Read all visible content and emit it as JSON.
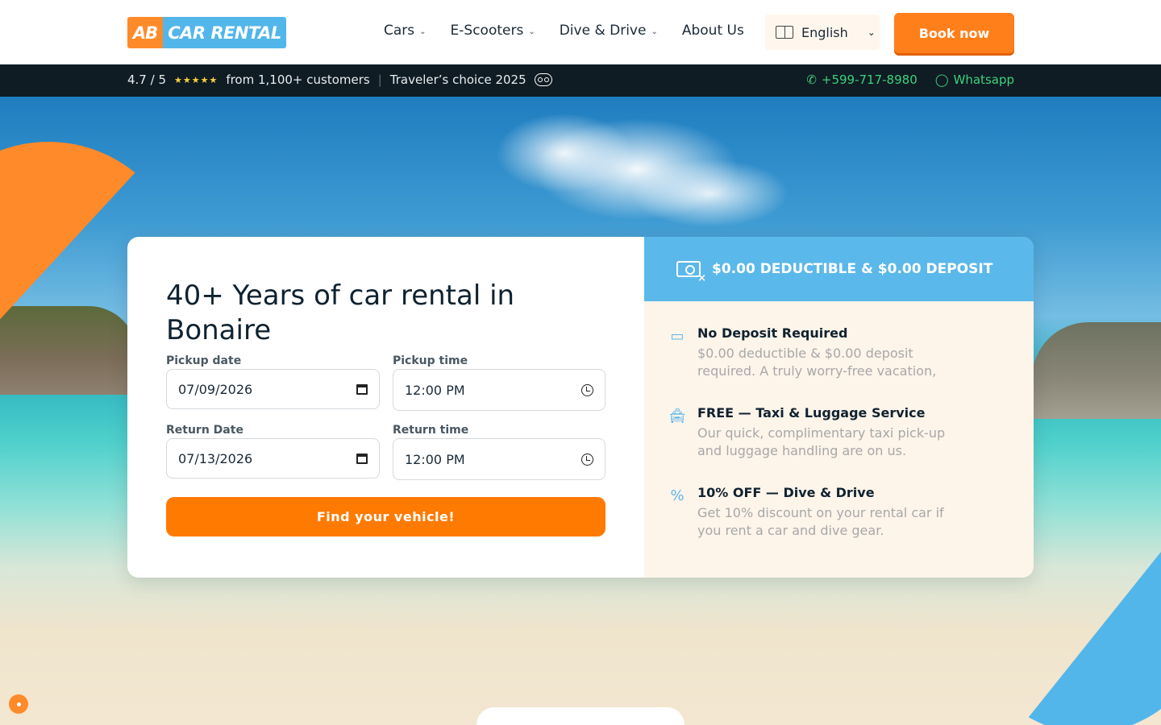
{
  "header": {
    "logo_left": "AB",
    "logo_right": "CAR RENTAL",
    "nav": [
      {
        "label": "Cars",
        "has_dropdown": true
      },
      {
        "label": "E-Scooters",
        "has_dropdown": true
      },
      {
        "label": "Dive & Drive",
        "has_dropdown": true
      },
      {
        "label": "About Us",
        "has_dropdown": false
      }
    ],
    "language": "English",
    "book_label": "Book now"
  },
  "infobar": {
    "rating": "4.7 / 5",
    "stars": "★★★★★",
    "customers": "from 1,100+ customers",
    "divider": "|",
    "award": "Traveler’s choice 2025",
    "phone": "+599-717-8980",
    "whatsapp": "Whatsapp"
  },
  "booking": {
    "headline": "40+ Years of car rental in Bonaire",
    "pickup_date_label": "Pickup date",
    "pickup_date_value": "07/09/2026",
    "pickup_time_label": "Pickup time",
    "pickup_time_value": "12:00 PM",
    "return_date_label": "Return Date",
    "return_date_value": "07/13/2026",
    "return_time_label": "Return time",
    "return_time_value": "12:00 PM",
    "find_label": "Find your vehicle!"
  },
  "promo": {
    "banner": "$0.00 DEDUCTIBLE & $0.00 DEPOSIT",
    "features": [
      {
        "icon": "money-off-icon",
        "title": "No Deposit Required",
        "text": "$0.00 deductible & $0.00 deposit required. A truly worry-free vacation,"
      },
      {
        "icon": "taxi-icon",
        "title": "FREE — Taxi & Luggage Service",
        "text": "Our quick, complimentary taxi pick-up and luggage handling are on us."
      },
      {
        "icon": "discount-icon",
        "title": "10% OFF — Dive & Drive",
        "text": "Get 10% discount on your rental car if you rent a car and dive gear."
      }
    ]
  },
  "colors": {
    "brand_orange": "#ff7f1a",
    "brand_blue": "#5bb8ea",
    "topbar": "#0f1c24",
    "accent_green": "#3ed07c"
  }
}
